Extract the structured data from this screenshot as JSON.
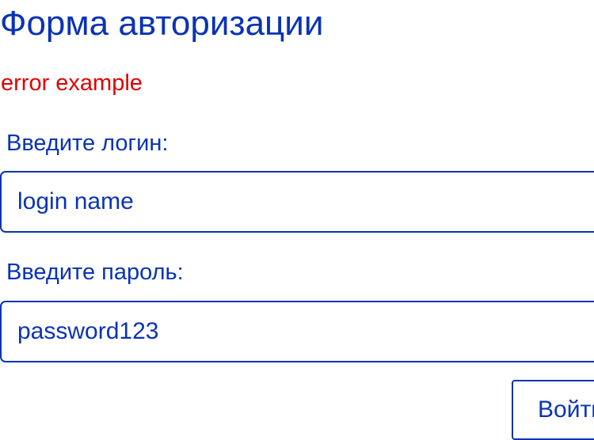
{
  "form": {
    "title": "Форма авторизации",
    "error": "error example",
    "login": {
      "label": "Введите логин:",
      "value": "login name"
    },
    "password": {
      "label": "Введите пароль:",
      "value": "password123"
    },
    "submit_label": "Войти"
  },
  "colors": {
    "primary": "#0a33b5",
    "error": "#e00000",
    "background": "#ffffff"
  }
}
